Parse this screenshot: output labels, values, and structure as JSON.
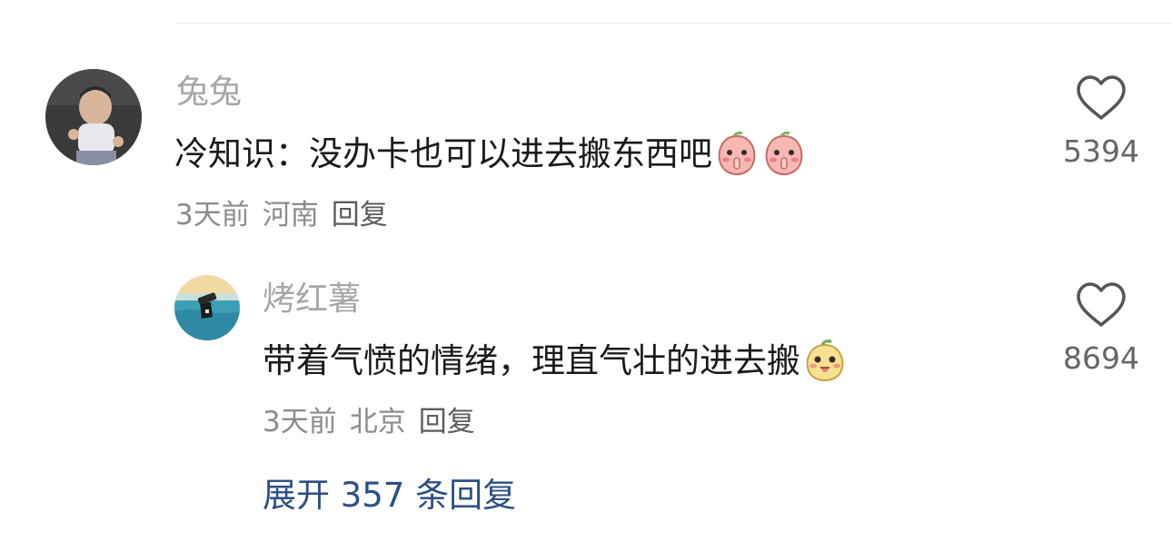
{
  "comments": [
    {
      "username": "兔兔",
      "text": "冷知识：没办卡也可以进去搬东西吧",
      "emojis": [
        "peach-shush-emoji-icon",
        "peach-shush-emoji-icon"
      ],
      "time": "3天前",
      "location": "河南",
      "reply_label": "回复",
      "like_count": "5394",
      "avatar_icon": "baby-photo-avatar"
    },
    {
      "username": "烤红薯",
      "text": "带着气愤的情绪，理直气壮的进去搬",
      "emojis": [
        "peach-cheeky-emoji-icon"
      ],
      "time": "3天前",
      "location": "北京",
      "reply_label": "回复",
      "like_count": "8694",
      "avatar_icon": "ocean-scene-avatar"
    }
  ],
  "expand_label": "展开 357 条回复",
  "icons": {
    "like": "heart-outline-icon"
  },
  "colors": {
    "link": "#2e4f85",
    "username": "#a6a6a6",
    "text": "#1a1a1a",
    "meta": "#8c8c8c"
  }
}
